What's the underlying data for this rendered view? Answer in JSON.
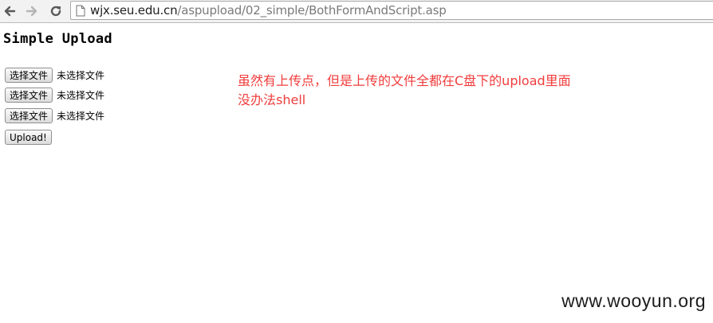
{
  "browser": {
    "back_icon": "arrow-left-icon",
    "forward_icon": "arrow-right-icon",
    "reload_icon": "reload-icon",
    "page_icon": "page-icon",
    "url_host": "wjx.seu.edu.cn",
    "url_path": "/aspupload/02_simple/BothFormAndScript.asp"
  },
  "page": {
    "title": "Simple Upload",
    "file_inputs": [
      {
        "button_label": "选择文件",
        "status": "未选择文件"
      },
      {
        "button_label": "选择文件",
        "status": "未选择文件"
      },
      {
        "button_label": "选择文件",
        "status": "未选择文件"
      }
    ],
    "upload_label": "Upload!"
  },
  "annotation": {
    "line1": "虽然有上传点，但是上传的文件全都在C盘下的upload里面",
    "line2": "没办法shell",
    "color": "#f03c3c"
  },
  "watermark": "www.wooyun.org"
}
